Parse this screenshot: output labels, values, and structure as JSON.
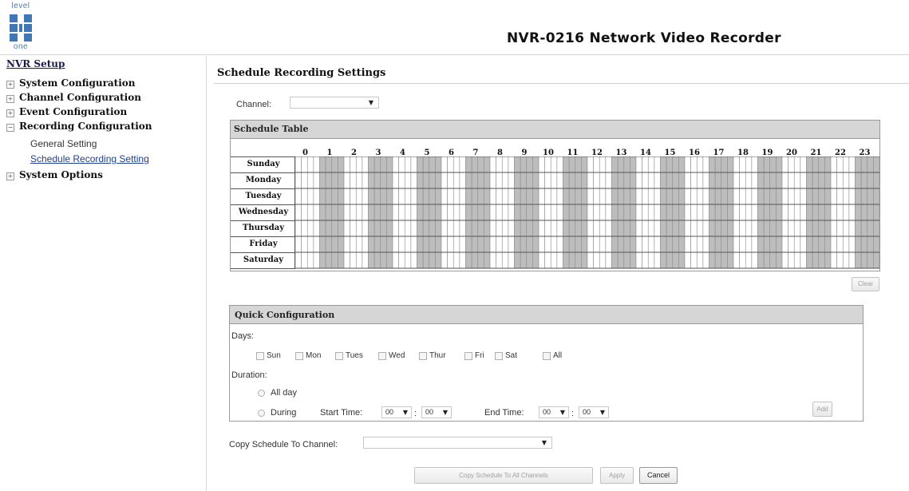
{
  "header": {
    "logo_line1": "level",
    "logo_line2": "one",
    "app_title": "NVR-0216 Network Video Recorder"
  },
  "sidebar": {
    "title": "NVR Setup",
    "items": [
      {
        "label": "System Configuration",
        "expanded": false
      },
      {
        "label": "Channel Configuration",
        "expanded": false
      },
      {
        "label": "Event Configuration",
        "expanded": false
      },
      {
        "label": "Recording Configuration",
        "expanded": true
      },
      {
        "label": "System Options",
        "expanded": false
      }
    ],
    "subitems": [
      {
        "label": "General Setting"
      },
      {
        "label": "Schedule Recording Setting"
      }
    ]
  },
  "main": {
    "title": "Schedule Recording Settings",
    "channel_label": "Channel:",
    "channel_value": "",
    "schedule_table": {
      "title": "Schedule Table",
      "hours": [
        "0",
        "1",
        "2",
        "3",
        "4",
        "5",
        "6",
        "7",
        "8",
        "9",
        "10",
        "11",
        "12",
        "13",
        "14",
        "15",
        "16",
        "17",
        "18",
        "19",
        "20",
        "21",
        "22",
        "23"
      ],
      "days": [
        "Sunday",
        "Monday",
        "Tuesday",
        "Wednesday",
        "Thursday",
        "Friday",
        "Saturday"
      ],
      "clear_label": "Clear"
    },
    "quick_config": {
      "title": "Quick Configuration",
      "days_label": "Days:",
      "day_options": [
        "Sun",
        "Mon",
        "Tues",
        "Wed",
        "Thur",
        "Fri",
        "Sat",
        "All"
      ],
      "duration_label": "Duration:",
      "all_day_label": "All day",
      "during_label": "During",
      "start_time_label": "Start Time:",
      "end_time_label": "End Time:",
      "start_hour": "00",
      "start_minute": "00",
      "end_hour": "00",
      "end_minute": "00",
      "time_separator": ":",
      "add_label": "Add"
    },
    "copy_schedule_label": "Copy Schedule To Channel:",
    "copy_schedule_value": "",
    "copy_all_label": "Copy Schedule To All Channels",
    "apply_label": "Apply",
    "cancel_label": "Cancel"
  },
  "colors": {
    "shaded_cell": "#bdbdbd",
    "header_bg": "#d6d6d6",
    "logo_blue": "#3f78b4"
  }
}
